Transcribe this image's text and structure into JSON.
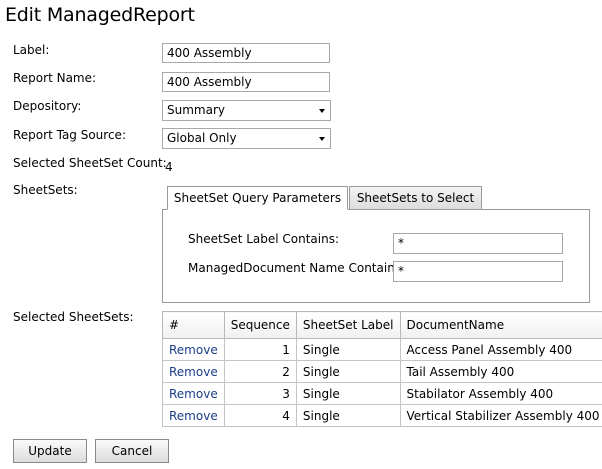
{
  "page": {
    "title": "Edit ManagedReport"
  },
  "form": {
    "label_label": "Label:",
    "label_value": "400 Assembly",
    "report_name_label": "Report Name:",
    "report_name_value": "400 Assembly",
    "depository_label": "Depository:",
    "depository_value": "Summary",
    "tag_source_label": "Report Tag Source:",
    "tag_source_value": "Global Only",
    "count_label": "Selected SheetSet Count:",
    "count_value": "4",
    "sheetsets_label": "SheetSets:",
    "selected_sheetsets_label": "Selected SheetSets:"
  },
  "tabs": [
    {
      "label": "SheetSet Query Parameters",
      "active": true
    },
    {
      "label": "SheetSets to Select",
      "active": false
    }
  ],
  "query": {
    "sheetset_label_contains_label": "SheetSet Label Contains:",
    "sheetset_label_contains_value": "*",
    "document_name_contains_label": "ManagedDocument Name Contains:",
    "document_name_contains_value": "*"
  },
  "table": {
    "headers": [
      "#",
      "Sequence",
      "SheetSet Label",
      "DocumentName"
    ],
    "rows": [
      {
        "action": "Remove",
        "sequence": "1",
        "label": "Single",
        "document": "Access Panel Assembly 400"
      },
      {
        "action": "Remove",
        "sequence": "2",
        "label": "Single",
        "document": "Tail Assembly 400"
      },
      {
        "action": "Remove",
        "sequence": "3",
        "label": "Single",
        "document": "Stabilator Assembly 400"
      },
      {
        "action": "Remove",
        "sequence": "4",
        "label": "Single",
        "document": "Vertical Stabilizer Assembly 400"
      }
    ]
  },
  "buttons": {
    "update": "Update",
    "cancel": "Cancel"
  }
}
